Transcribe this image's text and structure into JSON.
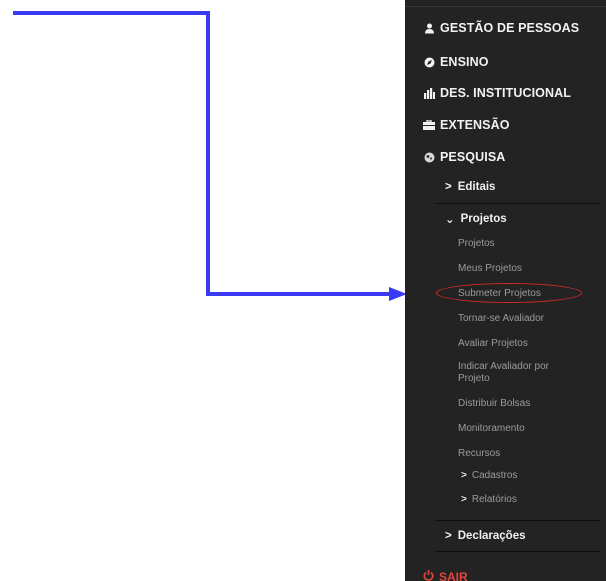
{
  "sidebar": {
    "main": [
      {
        "label": "GESTÃO DE PESSOAS",
        "icon": "person-icon"
      },
      {
        "label": "ENSINO",
        "icon": "compass-icon"
      },
      {
        "label": "DES. INSTITUCIONAL",
        "icon": "bar-chart-icon"
      },
      {
        "label": "EXTENSÃO",
        "icon": "briefcase-icon"
      },
      {
        "label": "PESQUISA",
        "icon": "flask-icon"
      }
    ],
    "pesquisa": {
      "editais": "Editais",
      "projetos": "Projetos",
      "projetos_items": [
        "Projetos",
        "Meus Projetos",
        "Submeter Projetos",
        "Tornar-se Avaliador",
        "Avaliar Projetos",
        "Indicar Avaliador por",
        "Projeto",
        "Distribuir Bolsas",
        "Monitoramento",
        "Recursos"
      ],
      "cadastros": "Cadastros",
      "relatorios": "Relatórios",
      "declaracoes": "Declarações"
    },
    "sair": "SAIR"
  },
  "colors": {
    "sidebar_bg": "#232323",
    "arrow": "#3a3af2",
    "highlight": "#d42a2a",
    "sair": "#e2463b"
  }
}
